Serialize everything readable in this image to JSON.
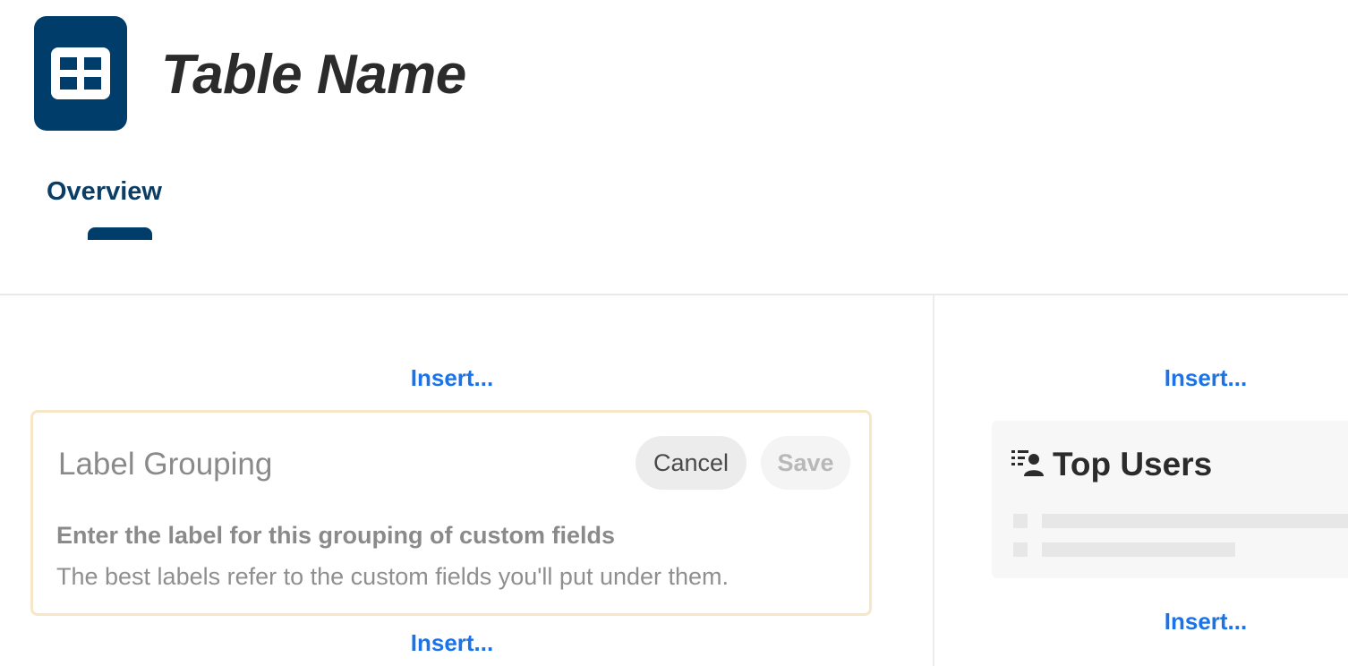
{
  "header": {
    "icon": "table-grid-icon",
    "title": "Table Name",
    "icon_bg_color": "#003d6b"
  },
  "tabs": [
    {
      "label": "Overview",
      "active": true
    }
  ],
  "left_column": {
    "insert_top_label": "Insert...",
    "insert_bottom_label": "Insert...",
    "label_editor": {
      "input_value": "",
      "input_placeholder": "Label Grouping",
      "cancel_label": "Cancel",
      "save_label": "Save",
      "save_enabled": false,
      "help_title": "Enter the label for this grouping of custom fields",
      "help_text": "The best labels refer to the custom fields you'll put under them.",
      "border_color": "#f8e6c9"
    }
  },
  "right_column": {
    "insert_top_label": "Insert...",
    "insert_bottom_label": "Insert...",
    "top_users_widget": {
      "icon": "user-list-icon",
      "title": "Top Users",
      "loading": true
    }
  },
  "colors": {
    "accent_link": "#1a73e8",
    "brand": "#003d6b"
  }
}
